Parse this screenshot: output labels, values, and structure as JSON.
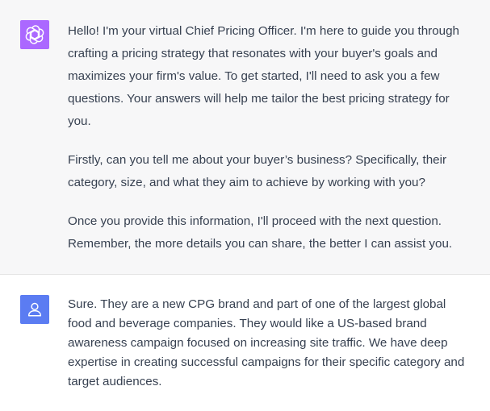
{
  "assistant_message": {
    "avatar_icon": "openai-logo-icon",
    "avatar_color": "#ab68ff",
    "paragraphs": [
      "Hello! I'm your virtual Chief Pricing Officer. I'm here to guide you through crafting a pricing strategy that resonates with your buyer's goals and maximizes your firm's value. To get started, I'll need to ask you a few questions. Your answers will help me tailor the best pricing strategy for you.",
      "Firstly, can you tell me about your buyer’s business? Specifically, their category, size, and what they aim to achieve by working with you?",
      "Once you provide this information, I'll proceed with the next question. Remember, the more details you can share, the better I can assist you."
    ]
  },
  "user_message": {
    "avatar_icon": "user-icon",
    "avatar_color": "#5b7cf2",
    "text": "Sure. They are a new CPG brand and part of one of the largest global food and beverage companies. They would like a US-based brand awareness campaign focused on increasing site traffic. We have deep expertise in creating successful campaigns for their specific category and target audiences."
  },
  "colors": {
    "assistant_bg": "#f7f7f8",
    "user_bg": "#ffffff",
    "text": "#374151"
  }
}
